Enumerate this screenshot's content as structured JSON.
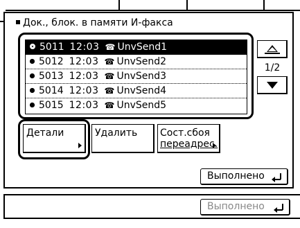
{
  "dialog": {
    "title": "Док., блок. в памяти И-факса"
  },
  "list": {
    "items": [
      {
        "id": "5011",
        "time": "12:03",
        "icon": "send-job-icon",
        "name": "UnvSend1",
        "selected": true
      },
      {
        "id": "5012",
        "time": "12:03",
        "icon": "send-job-icon",
        "name": "UnvSend2",
        "selected": false
      },
      {
        "id": "5013",
        "time": "12:03",
        "icon": "send-job-icon",
        "name": "UnvSend3",
        "selected": false
      },
      {
        "id": "5014",
        "time": "12:03",
        "icon": "send-job-icon",
        "name": "UnvSend4",
        "selected": false
      },
      {
        "id": "5015",
        "time": "12:03",
        "icon": "send-job-icon",
        "name": "UnvSend5",
        "selected": false
      }
    ],
    "page_indicator": "1/2"
  },
  "actions": {
    "details_label": "Детали",
    "delete_label": "Удалить",
    "forward_error_line1": "Сост.сбоя",
    "forward_error_line2": "переадрес."
  },
  "footer": {
    "done_label": "Выполнено",
    "outer_done_label": "Выполнено"
  },
  "colors": {
    "selected_row_bg": "#000000",
    "selected_row_text": "#ffffff",
    "disabled_text": "#888888"
  }
}
